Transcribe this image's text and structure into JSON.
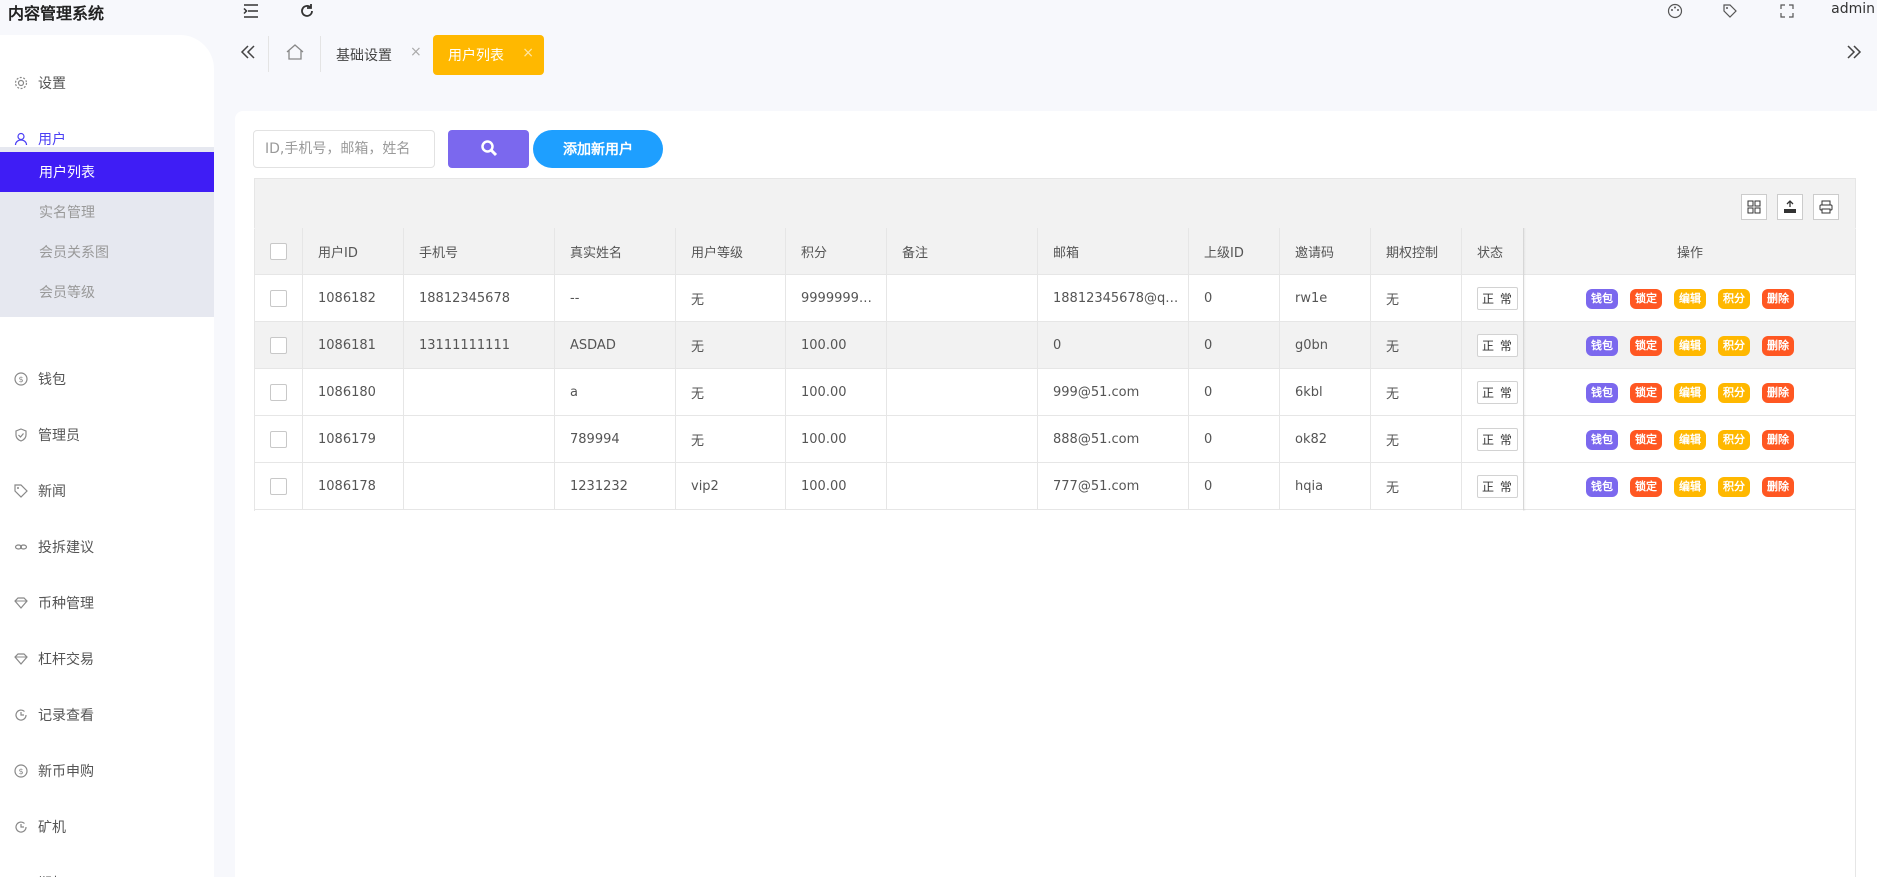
{
  "app": {
    "title": "内容管理系统",
    "user": "admin"
  },
  "sidebar": {
    "items": [
      {
        "label": "设置",
        "icon": "gear-icon"
      },
      {
        "label": "用户",
        "icon": "user-icon"
      },
      {
        "label": "钱包",
        "icon": "dollar-icon"
      },
      {
        "label": "管理员",
        "icon": "shield-icon"
      },
      {
        "label": "新闻",
        "icon": "tag-icon"
      },
      {
        "label": "投拆建议",
        "icon": "link-icon"
      },
      {
        "label": "币种管理",
        "icon": "diamond-icon"
      },
      {
        "label": "杠杆交易",
        "icon": "diamond-icon"
      },
      {
        "label": "记录查看",
        "icon": "refresh-icon"
      },
      {
        "label": "新币申购",
        "icon": "dollar-icon"
      },
      {
        "label": "矿机",
        "icon": "refresh-icon"
      },
      {
        "label": "期权",
        "icon": "refresh-icon"
      }
    ],
    "submenu": [
      {
        "label": "用户列表"
      },
      {
        "label": "实名管理"
      },
      {
        "label": "会员关系图"
      },
      {
        "label": "会员等级"
      }
    ]
  },
  "tabs": {
    "items": [
      {
        "label": "基础设置",
        "close": "×"
      },
      {
        "label": "用户列表",
        "close": "×"
      }
    ]
  },
  "search": {
    "placeholder": "ID,手机号，邮箱，姓名"
  },
  "toolbar": {
    "add_label": "添加新用户"
  },
  "table": {
    "headers": [
      "用户ID",
      "手机号",
      "真实姓名",
      "用户等级",
      "积分",
      "备注",
      "邮箱",
      "上级ID",
      "邀请码",
      "期权控制",
      "状态",
      "操作"
    ],
    "rows": [
      {
        "id": "1086182",
        "phone": "18812345678",
        "name": "--",
        "level": "无",
        "points": "9999999…",
        "remark": "",
        "email": "18812345678@q…",
        "parent": "0",
        "invite": "rw1e",
        "option": "无",
        "status": "正 常"
      },
      {
        "id": "1086181",
        "phone": "13111111111",
        "name": "ASDAD",
        "level": "无",
        "points": "100.00",
        "remark": "",
        "email": "0",
        "parent": "0",
        "invite": "g0bn",
        "option": "无",
        "status": "正 常"
      },
      {
        "id": "1086180",
        "phone": "",
        "name": "a",
        "level": "无",
        "points": "100.00",
        "remark": "",
        "email": "999@51.com",
        "parent": "0",
        "invite": "6kbl",
        "option": "无",
        "status": "正 常"
      },
      {
        "id": "1086179",
        "phone": "",
        "name": "789994",
        "level": "无",
        "points": "100.00",
        "remark": "",
        "email": "888@51.com",
        "parent": "0",
        "invite": "ok82",
        "option": "无",
        "status": "正 常"
      },
      {
        "id": "1086178",
        "phone": "",
        "name": "1231232",
        "level": "vip2",
        "points": "100.00",
        "remark": "",
        "email": "777@51.com",
        "parent": "0",
        "invite": "hqia",
        "option": "无",
        "status": "正 常"
      }
    ],
    "actions": [
      "钱包",
      "锁定",
      "编辑",
      "积分",
      "删除"
    ]
  },
  "colors": {
    "accent": "#3f1df5",
    "warning": "#ffb800",
    "primary": "#1e9fff",
    "purple": "#7b68ee",
    "danger": "#ff5722"
  }
}
